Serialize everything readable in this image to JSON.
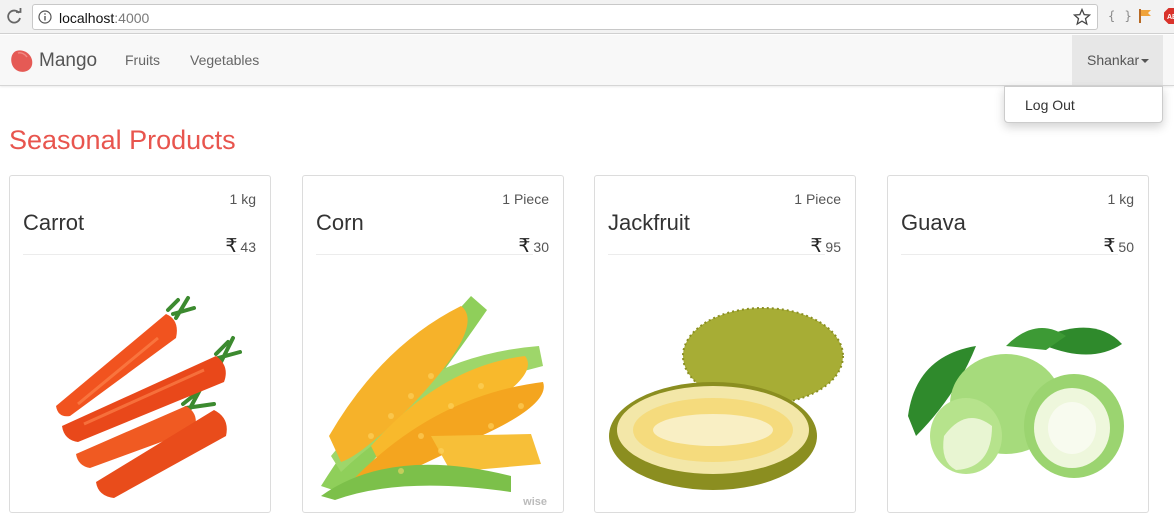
{
  "browser": {
    "url_host": "localhost",
    "url_port": ":4000",
    "extension_braces": "{ }"
  },
  "navbar": {
    "brand": "Mango",
    "links": [
      "Fruits",
      "Vegetables"
    ],
    "user": "Shankar",
    "dropdown": {
      "logout_label": "Log Out"
    }
  },
  "page": {
    "title": "Seasonal Products"
  },
  "currency_symbol": "₹",
  "products": [
    {
      "name": "Carrot",
      "quantity": "1 kg",
      "price": "43"
    },
    {
      "name": "Corn",
      "quantity": "1 Piece",
      "price": "30",
      "watermark": "wise"
    },
    {
      "name": "Jackfruit",
      "quantity": "1 Piece",
      "price": "95"
    },
    {
      "name": "Guava",
      "quantity": "1 kg",
      "price": "50"
    }
  ],
  "colors": {
    "accent": "#e8554e",
    "navbar_bg": "#f8f8f8",
    "user_bg": "#e7e7e7"
  }
}
